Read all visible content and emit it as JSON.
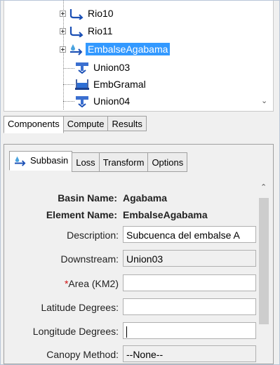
{
  "tree": {
    "items": [
      {
        "label": "Rio10",
        "icon": "subbasin-icon",
        "expandable": true,
        "selected": false
      },
      {
        "label": "Rio11",
        "icon": "subbasin-icon",
        "expandable": true,
        "selected": false
      },
      {
        "label": "EmbalseAgabama",
        "icon": "subbasin-icon",
        "expandable": true,
        "selected": true
      },
      {
        "label": "Union03",
        "icon": "junction-icon",
        "expandable": false,
        "selected": false
      },
      {
        "label": "EmbGramal",
        "icon": "reservoir-icon",
        "expandable": false,
        "selected": false
      },
      {
        "label": "Union04",
        "icon": "junction-icon",
        "expandable": false,
        "selected": false
      }
    ],
    "selection_color": "#3399ff"
  },
  "panel_tabs": {
    "items": [
      "Components",
      "Compute",
      "Results"
    ],
    "active": "Components"
  },
  "editor_tabs": {
    "items": [
      "Subbasin",
      "Loss",
      "Transform",
      "Options"
    ],
    "active": "Subbasin"
  },
  "form": {
    "basin_name_label": "Basin Name:",
    "basin_name_value": "Agabama",
    "element_name_label": "Element Name:",
    "element_name_value": "EmbalseAgabama",
    "description_label": "Description:",
    "description_value": "Subcuenca del embalse A",
    "downstream_label": "Downstream:",
    "downstream_value": "Union03",
    "area_required_mark": "*",
    "area_label": "Area (KM2)",
    "area_value": "",
    "latitude_label": "Latitude Degrees:",
    "latitude_value": "",
    "longitude_label": "Longitude Degrees:",
    "longitude_value": "",
    "canopy_label": "Canopy Method:",
    "canopy_value": "--None--"
  }
}
